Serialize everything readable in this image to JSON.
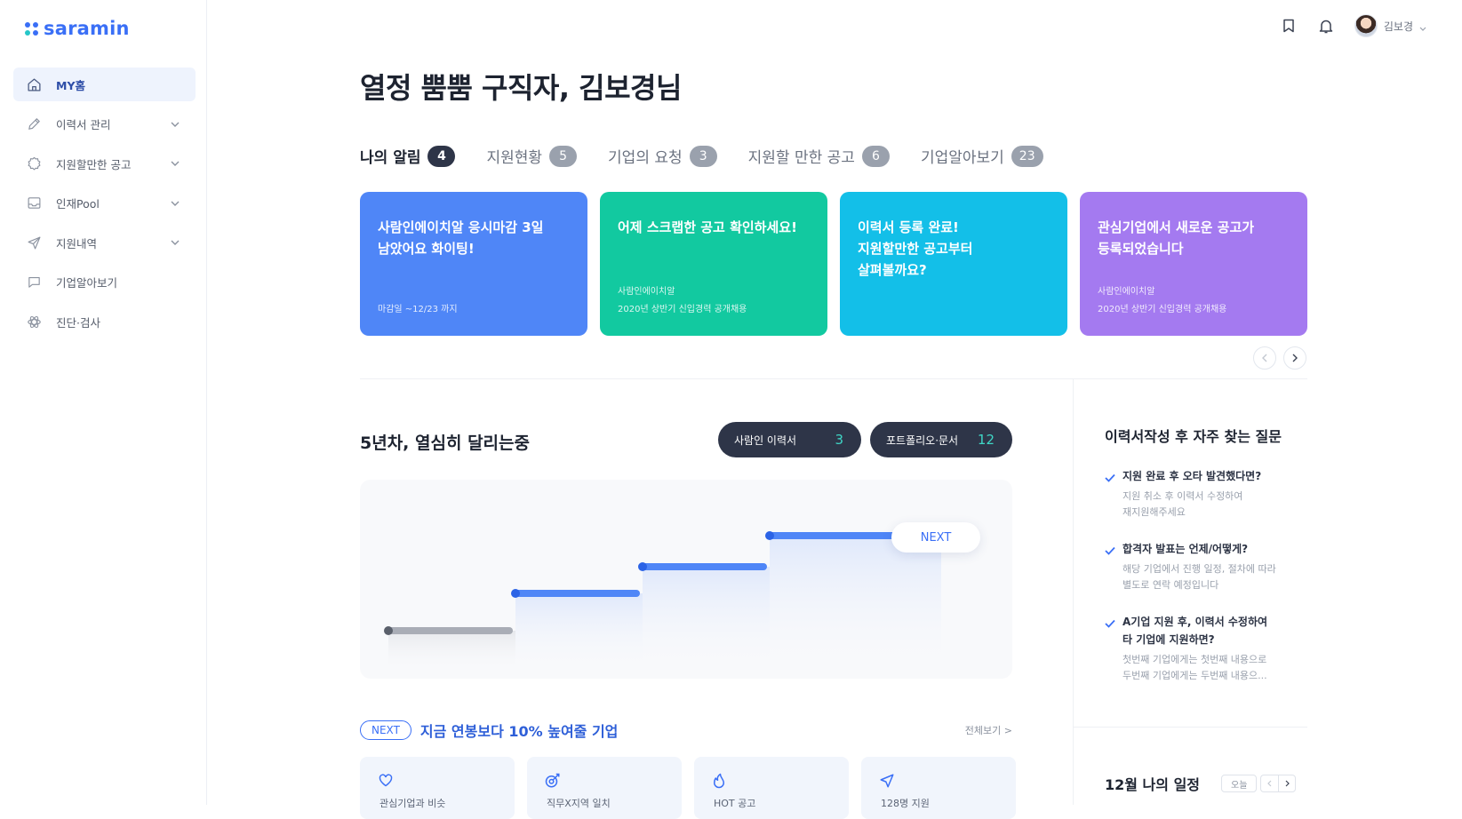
{
  "brand": {
    "name": "saramin",
    "dot_colors": [
      "#3a6ff6",
      "#3a6ff6",
      "#25c6c8",
      "#3a6ff6"
    ]
  },
  "sidebar": {
    "items": [
      {
        "label": "MY홈",
        "icon": "home-icon",
        "active": true,
        "has_chevron": false
      },
      {
        "label": "이력서 관리",
        "icon": "pencil-icon",
        "active": false,
        "has_chevron": true
      },
      {
        "label": "지원할만한 공고",
        "icon": "badge-icon",
        "active": false,
        "has_chevron": true
      },
      {
        "label": "인재Pool",
        "icon": "inbox-icon",
        "active": false,
        "has_chevron": true
      },
      {
        "label": "지원내역",
        "icon": "send-icon",
        "active": false,
        "has_chevron": true
      },
      {
        "label": "기업알아보기",
        "icon": "chat-icon",
        "active": false,
        "has_chevron": false
      },
      {
        "label": "진단·검사",
        "icon": "atom-icon",
        "active": false,
        "has_chevron": false
      }
    ]
  },
  "topbar": {
    "user_name": "김보경",
    "icons": [
      "bookmark-icon",
      "bell-icon"
    ]
  },
  "greeting": "열정 뿜뿜 구직자, 김보경님",
  "tabs": [
    {
      "label": "나의 알림",
      "count": "4",
      "active": true
    },
    {
      "label": "지원현황",
      "count": "5",
      "active": false
    },
    {
      "label": "기업의 요청",
      "count": "3",
      "active": false
    },
    {
      "label": "지원할 만한 공고",
      "count": "6",
      "active": false
    },
    {
      "label": "기업알아보기",
      "count": "23",
      "active": false
    }
  ],
  "cards": [
    {
      "title": "사람인에이치알 응시마감 3일\n남았어요 화이팅!",
      "sub": "마감일 ~12/23 까지",
      "color": "#4f86f7"
    },
    {
      "title": "어제 스크랩한 공고 확인하세요!",
      "sub": "사람인에이치알\n2020년 상반기 신입경력 공개채용",
      "color": "#12c9a0"
    },
    {
      "title": "이력서 등록 완료!\n지원할만한 공고부터\n살펴볼까요?",
      "sub": "",
      "color": "#13bfe8"
    },
    {
      "title": "관심기업에서 새로운 공고가\n등록되었습니다",
      "sub": "사람인에이치알\n2020년 상반기 신입경력 공개채용",
      "color": "#a47af0"
    }
  ],
  "career": {
    "title": "5년차, 열심히 달리는중",
    "pills": [
      {
        "label": "사람인 이력서",
        "count": "3"
      },
      {
        "label": "포트폴리오·문서",
        "count": "12"
      }
    ],
    "next_label": "NEXT"
  },
  "next_section": {
    "badge": "NEXT",
    "text": "지금 연봉보다 10% 높여줄 기업",
    "more": "전체보기 >",
    "cards": [
      {
        "icon": "heart-icon",
        "label": "관심기업과 비슷"
      },
      {
        "icon": "target-icon",
        "label": "직무X지역 일치"
      },
      {
        "icon": "fire-icon",
        "label": "HOT 공고"
      },
      {
        "icon": "send-icon",
        "label": "128명 지원"
      }
    ]
  },
  "faq": {
    "title": "이력서작성 후 자주 찾는 질문",
    "items": [
      {
        "q": "지원 완료 후 오타 발견했다면?",
        "a": "지원 취소 후 이력서 수정하여\n재지원해주세요"
      },
      {
        "q": "합격자 발표는 언제/어떻게?",
        "a": "해당 기업에서 진행 일정, 절차에 따라\n별도로 연락 예정입니다"
      },
      {
        "q": "A기업 지원 후, 이력서 수정하여\n타 기업에 지원하면?",
        "a": "첫번째 기업에게는 첫번째 내용으로\n두번째 기업에게는 두번째 내용으..."
      }
    ]
  },
  "schedule": {
    "title": "12월 나의 일정",
    "today": "오늘"
  }
}
